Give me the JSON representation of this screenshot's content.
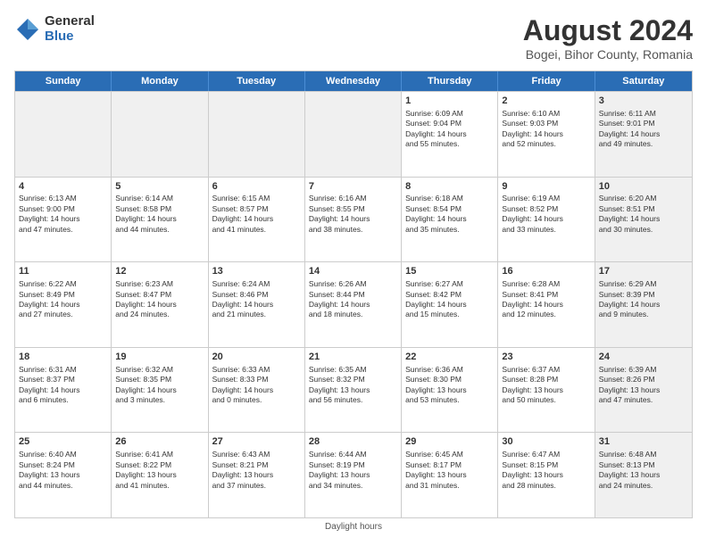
{
  "logo": {
    "general": "General",
    "blue": "Blue"
  },
  "title": "August 2024",
  "subtitle": "Bogei, Bihor County, Romania",
  "header_days": [
    "Sunday",
    "Monday",
    "Tuesday",
    "Wednesday",
    "Thursday",
    "Friday",
    "Saturday"
  ],
  "footer": "Daylight hours",
  "weeks": [
    [
      {
        "day": "",
        "info": "",
        "shaded": true
      },
      {
        "day": "",
        "info": "",
        "shaded": true
      },
      {
        "day": "",
        "info": "",
        "shaded": true
      },
      {
        "day": "",
        "info": "",
        "shaded": true
      },
      {
        "day": "1",
        "info": "Sunrise: 6:09 AM\nSunset: 9:04 PM\nDaylight: 14 hours\nand 55 minutes.",
        "shaded": false
      },
      {
        "day": "2",
        "info": "Sunrise: 6:10 AM\nSunset: 9:03 PM\nDaylight: 14 hours\nand 52 minutes.",
        "shaded": false
      },
      {
        "day": "3",
        "info": "Sunrise: 6:11 AM\nSunset: 9:01 PM\nDaylight: 14 hours\nand 49 minutes.",
        "shaded": true
      }
    ],
    [
      {
        "day": "4",
        "info": "Sunrise: 6:13 AM\nSunset: 9:00 PM\nDaylight: 14 hours\nand 47 minutes.",
        "shaded": false
      },
      {
        "day": "5",
        "info": "Sunrise: 6:14 AM\nSunset: 8:58 PM\nDaylight: 14 hours\nand 44 minutes.",
        "shaded": false
      },
      {
        "day": "6",
        "info": "Sunrise: 6:15 AM\nSunset: 8:57 PM\nDaylight: 14 hours\nand 41 minutes.",
        "shaded": false
      },
      {
        "day": "7",
        "info": "Sunrise: 6:16 AM\nSunset: 8:55 PM\nDaylight: 14 hours\nand 38 minutes.",
        "shaded": false
      },
      {
        "day": "8",
        "info": "Sunrise: 6:18 AM\nSunset: 8:54 PM\nDaylight: 14 hours\nand 35 minutes.",
        "shaded": false
      },
      {
        "day": "9",
        "info": "Sunrise: 6:19 AM\nSunset: 8:52 PM\nDaylight: 14 hours\nand 33 minutes.",
        "shaded": false
      },
      {
        "day": "10",
        "info": "Sunrise: 6:20 AM\nSunset: 8:51 PM\nDaylight: 14 hours\nand 30 minutes.",
        "shaded": true
      }
    ],
    [
      {
        "day": "11",
        "info": "Sunrise: 6:22 AM\nSunset: 8:49 PM\nDaylight: 14 hours\nand 27 minutes.",
        "shaded": false
      },
      {
        "day": "12",
        "info": "Sunrise: 6:23 AM\nSunset: 8:47 PM\nDaylight: 14 hours\nand 24 minutes.",
        "shaded": false
      },
      {
        "day": "13",
        "info": "Sunrise: 6:24 AM\nSunset: 8:46 PM\nDaylight: 14 hours\nand 21 minutes.",
        "shaded": false
      },
      {
        "day": "14",
        "info": "Sunrise: 6:26 AM\nSunset: 8:44 PM\nDaylight: 14 hours\nand 18 minutes.",
        "shaded": false
      },
      {
        "day": "15",
        "info": "Sunrise: 6:27 AM\nSunset: 8:42 PM\nDaylight: 14 hours\nand 15 minutes.",
        "shaded": false
      },
      {
        "day": "16",
        "info": "Sunrise: 6:28 AM\nSunset: 8:41 PM\nDaylight: 14 hours\nand 12 minutes.",
        "shaded": false
      },
      {
        "day": "17",
        "info": "Sunrise: 6:29 AM\nSunset: 8:39 PM\nDaylight: 14 hours\nand 9 minutes.",
        "shaded": true
      }
    ],
    [
      {
        "day": "18",
        "info": "Sunrise: 6:31 AM\nSunset: 8:37 PM\nDaylight: 14 hours\nand 6 minutes.",
        "shaded": false
      },
      {
        "day": "19",
        "info": "Sunrise: 6:32 AM\nSunset: 8:35 PM\nDaylight: 14 hours\nand 3 minutes.",
        "shaded": false
      },
      {
        "day": "20",
        "info": "Sunrise: 6:33 AM\nSunset: 8:33 PM\nDaylight: 14 hours\nand 0 minutes.",
        "shaded": false
      },
      {
        "day": "21",
        "info": "Sunrise: 6:35 AM\nSunset: 8:32 PM\nDaylight: 13 hours\nand 56 minutes.",
        "shaded": false
      },
      {
        "day": "22",
        "info": "Sunrise: 6:36 AM\nSunset: 8:30 PM\nDaylight: 13 hours\nand 53 minutes.",
        "shaded": false
      },
      {
        "day": "23",
        "info": "Sunrise: 6:37 AM\nSunset: 8:28 PM\nDaylight: 13 hours\nand 50 minutes.",
        "shaded": false
      },
      {
        "day": "24",
        "info": "Sunrise: 6:39 AM\nSunset: 8:26 PM\nDaylight: 13 hours\nand 47 minutes.",
        "shaded": true
      }
    ],
    [
      {
        "day": "25",
        "info": "Sunrise: 6:40 AM\nSunset: 8:24 PM\nDaylight: 13 hours\nand 44 minutes.",
        "shaded": false
      },
      {
        "day": "26",
        "info": "Sunrise: 6:41 AM\nSunset: 8:22 PM\nDaylight: 13 hours\nand 41 minutes.",
        "shaded": false
      },
      {
        "day": "27",
        "info": "Sunrise: 6:43 AM\nSunset: 8:21 PM\nDaylight: 13 hours\nand 37 minutes.",
        "shaded": false
      },
      {
        "day": "28",
        "info": "Sunrise: 6:44 AM\nSunset: 8:19 PM\nDaylight: 13 hours\nand 34 minutes.",
        "shaded": false
      },
      {
        "day": "29",
        "info": "Sunrise: 6:45 AM\nSunset: 8:17 PM\nDaylight: 13 hours\nand 31 minutes.",
        "shaded": false
      },
      {
        "day": "30",
        "info": "Sunrise: 6:47 AM\nSunset: 8:15 PM\nDaylight: 13 hours\nand 28 minutes.",
        "shaded": false
      },
      {
        "day": "31",
        "info": "Sunrise: 6:48 AM\nSunset: 8:13 PM\nDaylight: 13 hours\nand 24 minutes.",
        "shaded": true
      }
    ]
  ]
}
